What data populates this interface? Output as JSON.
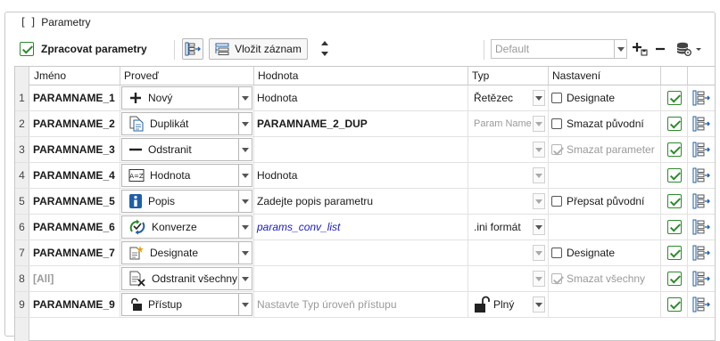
{
  "group": {
    "title": "Parametry"
  },
  "toolbar": {
    "process_label": "Zpracovat parametry",
    "process_checked": true,
    "insert_label": "Vložit záznam",
    "preset_placeholder": "Default"
  },
  "columns": [
    "Jméno",
    "Proveď",
    "Hodnota",
    "Typ",
    "Nastavení"
  ],
  "rows": [
    {
      "num": "1",
      "name": "PARAMNAME_1",
      "action": "Nový",
      "action_icon": "plus-icon",
      "value": "Hodnota",
      "value_style": "normal",
      "type": "Řetězec",
      "type_style": "normal",
      "setting_label": "Designate",
      "setting_checked": false,
      "setting_style": "normal",
      "valid": true
    },
    {
      "num": "2",
      "name": "PARAMNAME_2",
      "action": "Duplikát",
      "action_icon": "duplicate-icon",
      "value": "PARAMNAME_2_DUP",
      "value_style": "bold",
      "type": "Param Name",
      "type_style": "gray",
      "setting_label": "Smazat původní",
      "setting_checked": false,
      "setting_style": "normal",
      "valid": true
    },
    {
      "num": "3",
      "name": "PARAMNAME_3",
      "action": "Odstranit",
      "action_icon": "minus-icon",
      "value": "",
      "value_style": "normal",
      "type": "",
      "type_style": "gray",
      "setting_label": "Smazat parameter",
      "setting_checked": true,
      "setting_style": "gray",
      "valid": true
    },
    {
      "num": "4",
      "name": "PARAMNAME_4",
      "action": "Hodnota",
      "action_icon": "value-icon",
      "value": "Hodnota",
      "value_style": "normal",
      "type": "",
      "type_style": "gray",
      "setting_label": "",
      "setting_checked": null,
      "setting_style": "none",
      "valid": true
    },
    {
      "num": "5",
      "name": "PARAMNAME_5",
      "action": "Popis",
      "action_icon": "info-icon",
      "value": "Zadejte popis parametru",
      "value_style": "normal",
      "type": "",
      "type_style": "gray",
      "setting_label": "Přepsat původní",
      "setting_checked": false,
      "setting_style": "normal",
      "valid": true
    },
    {
      "num": "6",
      "name": "PARAMNAME_6",
      "action": "Konverze",
      "action_icon": "convert-icon",
      "value": "params_conv_list",
      "value_style": "link",
      "type": ".ini formát",
      "type_style": "normal",
      "setting_label": "",
      "setting_checked": null,
      "setting_style": "none",
      "valid": true
    },
    {
      "num": "7",
      "name": "PARAMNAME_7",
      "action": "Designate",
      "action_icon": "designate-icon",
      "value": "",
      "value_style": "normal",
      "type": "",
      "type_style": "gray",
      "setting_label": "Designate",
      "setting_checked": false,
      "setting_style": "normal",
      "valid": true
    },
    {
      "num": "8",
      "name": "[All]",
      "name_dim": true,
      "action": "Odstranit všechny",
      "action_icon": "delete-all-icon",
      "value": "",
      "value_style": "normal",
      "type": "",
      "type_style": "gray",
      "setting_label": "Smazat všechny",
      "setting_checked": true,
      "setting_style": "gray",
      "valid": true
    },
    {
      "num": "9",
      "name": "PARAMNAME_9",
      "action": "Přístup",
      "action_icon": "lock-icon",
      "value": "Nastavte Typ úroveň přístupu",
      "value_style": "placeholder",
      "type": "Plný",
      "type_style": "lock",
      "setting_label": "",
      "setting_checked": null,
      "setting_style": "none",
      "valid": true
    }
  ],
  "colors": {
    "check_green": "#2c8a2c",
    "link_blue": "#1a1acc",
    "placeholder_gray": "#9a9a9a",
    "icon_blue": "#1f5fa8"
  }
}
